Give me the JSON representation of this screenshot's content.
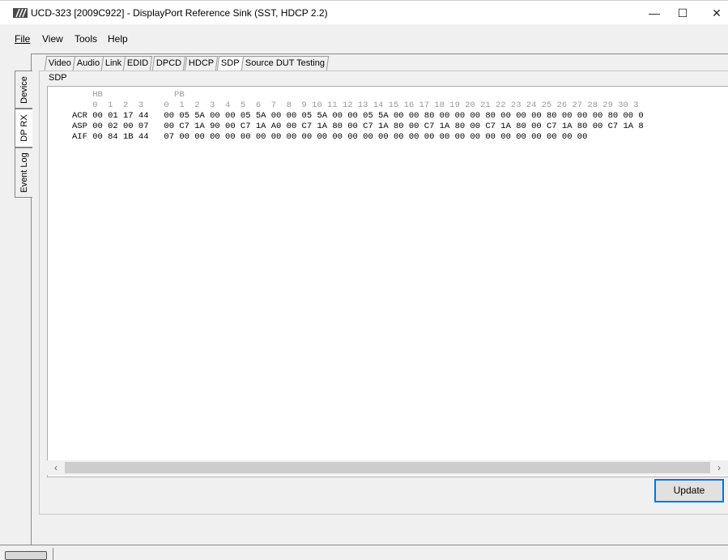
{
  "window": {
    "title": "UCD-323 [2009C922] - DisplayPort Reference Sink (SST, HDCP 2.2)",
    "minimize": "—",
    "maximize": "☐",
    "close": "✕"
  },
  "menu": {
    "file": "File",
    "view": "View",
    "tools": "Tools",
    "help": "Help"
  },
  "side_tabs": {
    "device": "Device",
    "dp_rx": "DP RX",
    "event_log": "Event Log",
    "active": "DP RX"
  },
  "tabs": [
    "Video",
    "Audio",
    "Link",
    "EDID",
    "DPCD",
    "HDCP",
    "SDP",
    "Source DUT Testing"
  ],
  "active_tab": "SDP",
  "group_title": "SDP",
  "sdp": {
    "header_labels": "    HB              PB",
    "header_indices": "    0  1  2  3    0  1  2  3  4  5  6  7  8  9 10 11 12 13 14 15 16 17 18 19 20 21 22 23 24 25 26 27 28 29 30 3",
    "rows": [
      "ACR 00 01 17 44   00 05 5A 00 00 05 5A 00 00 05 5A 00 00 05 5A 00 00 80 00 00 00 80 00 00 00 80 00 00 00 80 00 0",
      "ASP 00 02 00 07   00 C7 1A 90 00 C7 1A A0 00 C7 1A 80 00 C7 1A 80 00 C7 1A 80 00 C7 1A 80 00 C7 1A 80 00 C7 1A 8",
      "AIF 00 84 1B 44   07 00 00 00 00 00 00 00 00 00 00 00 00 00 00 00 00 00 00 00 00 00 00 00 00 00 00 00"
    ]
  },
  "scroll": {
    "left": "‹",
    "right": "›"
  },
  "update_button": "Update"
}
